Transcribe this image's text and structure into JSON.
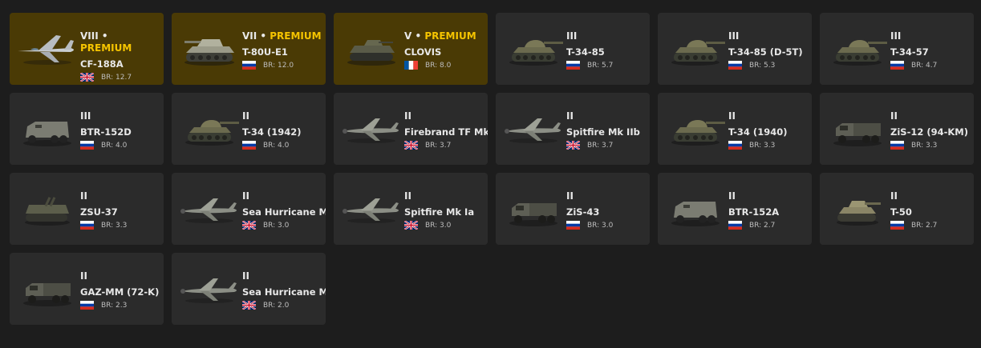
{
  "premium_label": "PREMIUM",
  "br_prefix": "BR:",
  "colors": {
    "card": "#2b2b2b",
    "premium_card": "#4a3a05",
    "premium_text": "#f5c400",
    "background": "#1d1d1d"
  },
  "vehicles": [
    {
      "tier": "VIII",
      "premium": true,
      "name": "CF-188A",
      "nation": "uk",
      "br": "12.7",
      "type": "jet"
    },
    {
      "tier": "VII",
      "premium": true,
      "name": "T-80U-E1",
      "nation": "ussr",
      "br": "12.0",
      "type": "mbt"
    },
    {
      "tier": "V",
      "premium": true,
      "name": "CLOVIS",
      "nation": "france",
      "br": "8.0",
      "type": "ifv"
    },
    {
      "tier": "III",
      "premium": false,
      "name": "T-34-85",
      "nation": "ussr",
      "br": "5.7",
      "type": "tank"
    },
    {
      "tier": "III",
      "premium": false,
      "name": "T-34-85 (D-5T)",
      "nation": "ussr",
      "br": "5.3",
      "type": "tank"
    },
    {
      "tier": "III",
      "premium": false,
      "name": "T-34-57",
      "nation": "ussr",
      "br": "4.7",
      "type": "tank"
    },
    {
      "tier": "III",
      "premium": false,
      "name": "BTR-152D",
      "nation": "ussr",
      "br": "4.0",
      "type": "apc"
    },
    {
      "tier": "II",
      "premium": false,
      "name": "T-34 (1942)",
      "nation": "ussr",
      "br": "4.0",
      "type": "tank"
    },
    {
      "tier": "II",
      "premium": false,
      "name": "Firebrand TF Mk IV",
      "nation": "uk",
      "br": "3.7",
      "type": "plane"
    },
    {
      "tier": "II",
      "premium": false,
      "name": "Spitfire Mk IIb",
      "nation": "uk",
      "br": "3.7",
      "type": "plane"
    },
    {
      "tier": "II",
      "premium": false,
      "name": "T-34 (1940)",
      "nation": "ussr",
      "br": "3.3",
      "type": "tank"
    },
    {
      "tier": "II",
      "premium": false,
      "name": "ZiS-12 (94-KM)",
      "nation": "ussr",
      "br": "3.3",
      "type": "truck"
    },
    {
      "tier": "II",
      "premium": false,
      "name": "ZSU-37",
      "nation": "ussr",
      "br": "3.3",
      "type": "spaa"
    },
    {
      "tier": "II",
      "premium": false,
      "name": "Sea Hurricane Mk IC",
      "nation": "uk",
      "br": "3.0",
      "type": "plane"
    },
    {
      "tier": "II",
      "premium": false,
      "name": "Spitfire Mk Ia",
      "nation": "uk",
      "br": "3.0",
      "type": "plane"
    },
    {
      "tier": "II",
      "premium": false,
      "name": "ZiS-43",
      "nation": "ussr",
      "br": "3.0",
      "type": "truck"
    },
    {
      "tier": "II",
      "premium": false,
      "name": "BTR-152A",
      "nation": "ussr",
      "br": "2.7",
      "type": "apc"
    },
    {
      "tier": "II",
      "premium": false,
      "name": "T-50",
      "nation": "ussr",
      "br": "2.7",
      "type": "light"
    },
    {
      "tier": "II",
      "premium": false,
      "name": "GAZ-MM (72-K)",
      "nation": "ussr",
      "br": "2.3",
      "type": "truck"
    },
    {
      "tier": "II",
      "premium": false,
      "name": "Sea Hurricane Mk I",
      "nation": "uk",
      "br": "2.0",
      "type": "plane"
    }
  ]
}
